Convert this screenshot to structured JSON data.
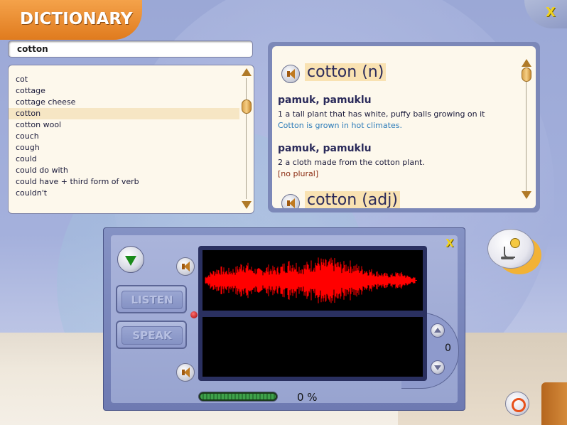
{
  "app": {
    "title": "DICTIONARY",
    "close_icon": "close-x-icon",
    "accent_color": "#e88a2a",
    "close_color": "#f1d21e"
  },
  "search": {
    "value": "cotton"
  },
  "word_list": {
    "items": [
      {
        "label": "cot",
        "selected": false
      },
      {
        "label": "cottage",
        "selected": false
      },
      {
        "label": "cottage cheese",
        "selected": false
      },
      {
        "label": "cotton",
        "selected": true
      },
      {
        "label": "cotton wool",
        "selected": false
      },
      {
        "label": "couch",
        "selected": false
      },
      {
        "label": "cough",
        "selected": false
      },
      {
        "label": "could",
        "selected": false
      },
      {
        "label": "could do with",
        "selected": false
      },
      {
        "label": "could have + third form of verb",
        "selected": false
      },
      {
        "label": "couldn't",
        "selected": false
      }
    ]
  },
  "definition": {
    "entries": [
      {
        "headword": "cotton (n)",
        "senses": [
          {
            "translation": "pamuk, pamuklu",
            "definition": "1 a tall plant that has white, puffy balls growing on it",
            "example": "Cotton is grown in hot climates.",
            "note": ""
          },
          {
            "translation": "pamuk, pamuklu",
            "definition": "2 a cloth made from the cotton plant.",
            "example": "",
            "note": "[no plural]"
          }
        ]
      },
      {
        "headword": "cotton (adj)",
        "senses": []
      }
    ]
  },
  "recorder": {
    "listen_label": "LISTEN",
    "speak_label": "SPEAK",
    "counter": "0",
    "progress_percent": 0,
    "percent_label": "0 %",
    "waveform_color": "#ff0000"
  }
}
